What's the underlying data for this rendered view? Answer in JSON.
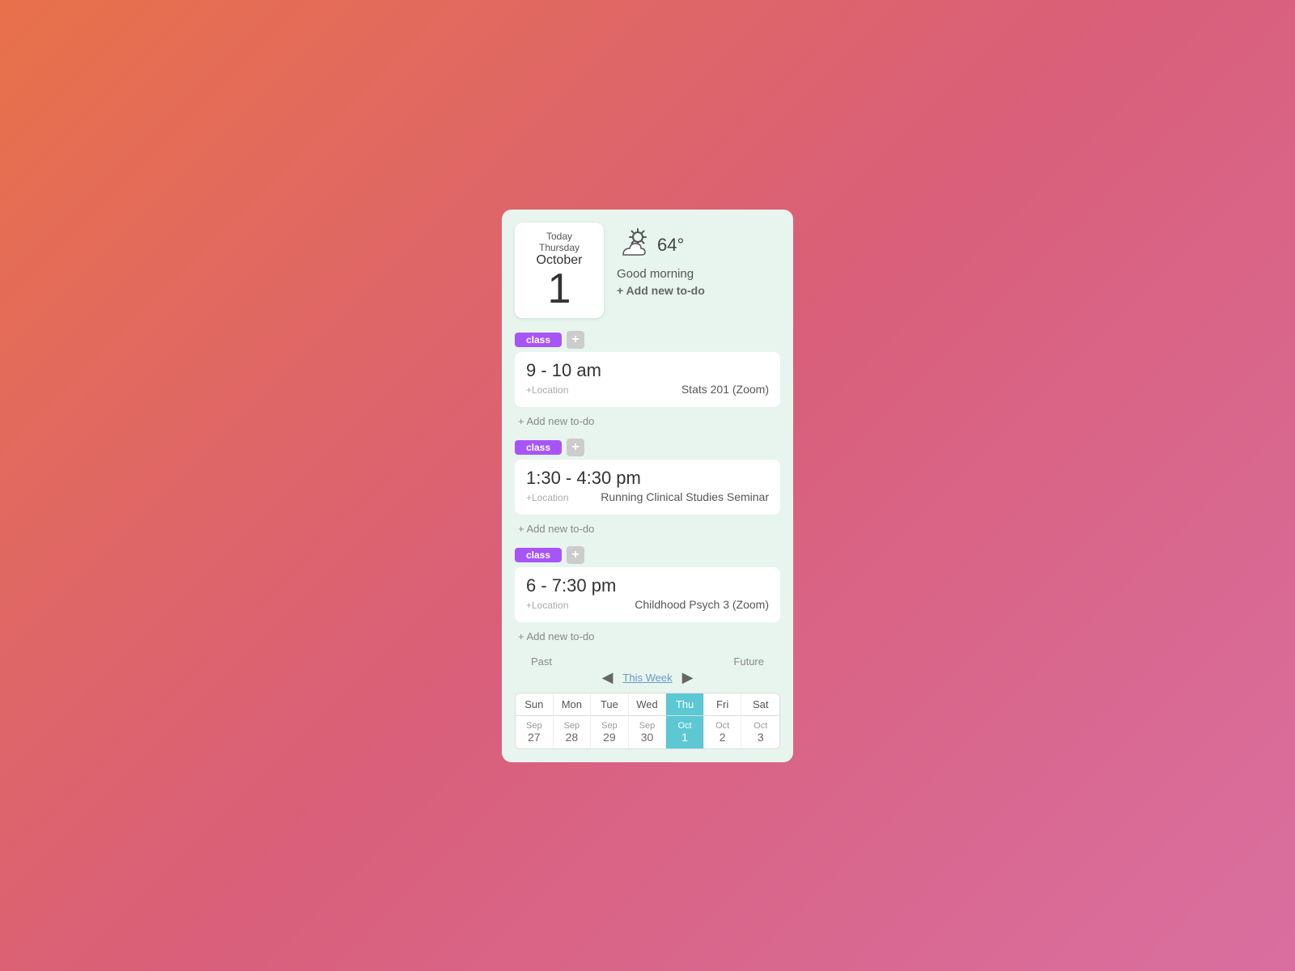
{
  "header": {
    "today_label": "Today",
    "weekday": "Thursday",
    "month": "October",
    "day": "1",
    "temperature": "64°",
    "greeting": "Good morning",
    "add_todo": "+ Add new to-do"
  },
  "events": [
    {
      "tag": "class",
      "time": "9 - 10 am",
      "location": "+Location",
      "title": "Stats 201 (Zoom)"
    },
    {
      "tag": "class",
      "time": "1:30 - 4:30 pm",
      "location": "+Location",
      "title": "Running Clinical Studies Seminar"
    },
    {
      "tag": "class",
      "time": "6 - 7:30 pm",
      "location": "+Location",
      "title": "Childhood Psych 3 (Zoom)"
    }
  ],
  "add_todo_label": "+ Add new to-do",
  "calendar": {
    "past_label": "Past",
    "future_label": "Future",
    "this_week_label": "This Week",
    "days": [
      {
        "header": "Sun",
        "month_label": "Sep",
        "date": "27",
        "active": false
      },
      {
        "header": "Mon",
        "month_label": "Sep",
        "date": "28",
        "active": false
      },
      {
        "header": "Tue",
        "month_label": "Sep",
        "date": "29",
        "active": false
      },
      {
        "header": "Wed",
        "month_label": "Sep",
        "date": "30",
        "active": false
      },
      {
        "header": "Thu",
        "month_label": "Oct",
        "date": "1",
        "active": true
      },
      {
        "header": "Fri",
        "month_label": "Oct",
        "date": "2",
        "active": false
      },
      {
        "header": "Sat",
        "month_label": "Oct",
        "date": "3",
        "active": false
      }
    ]
  }
}
